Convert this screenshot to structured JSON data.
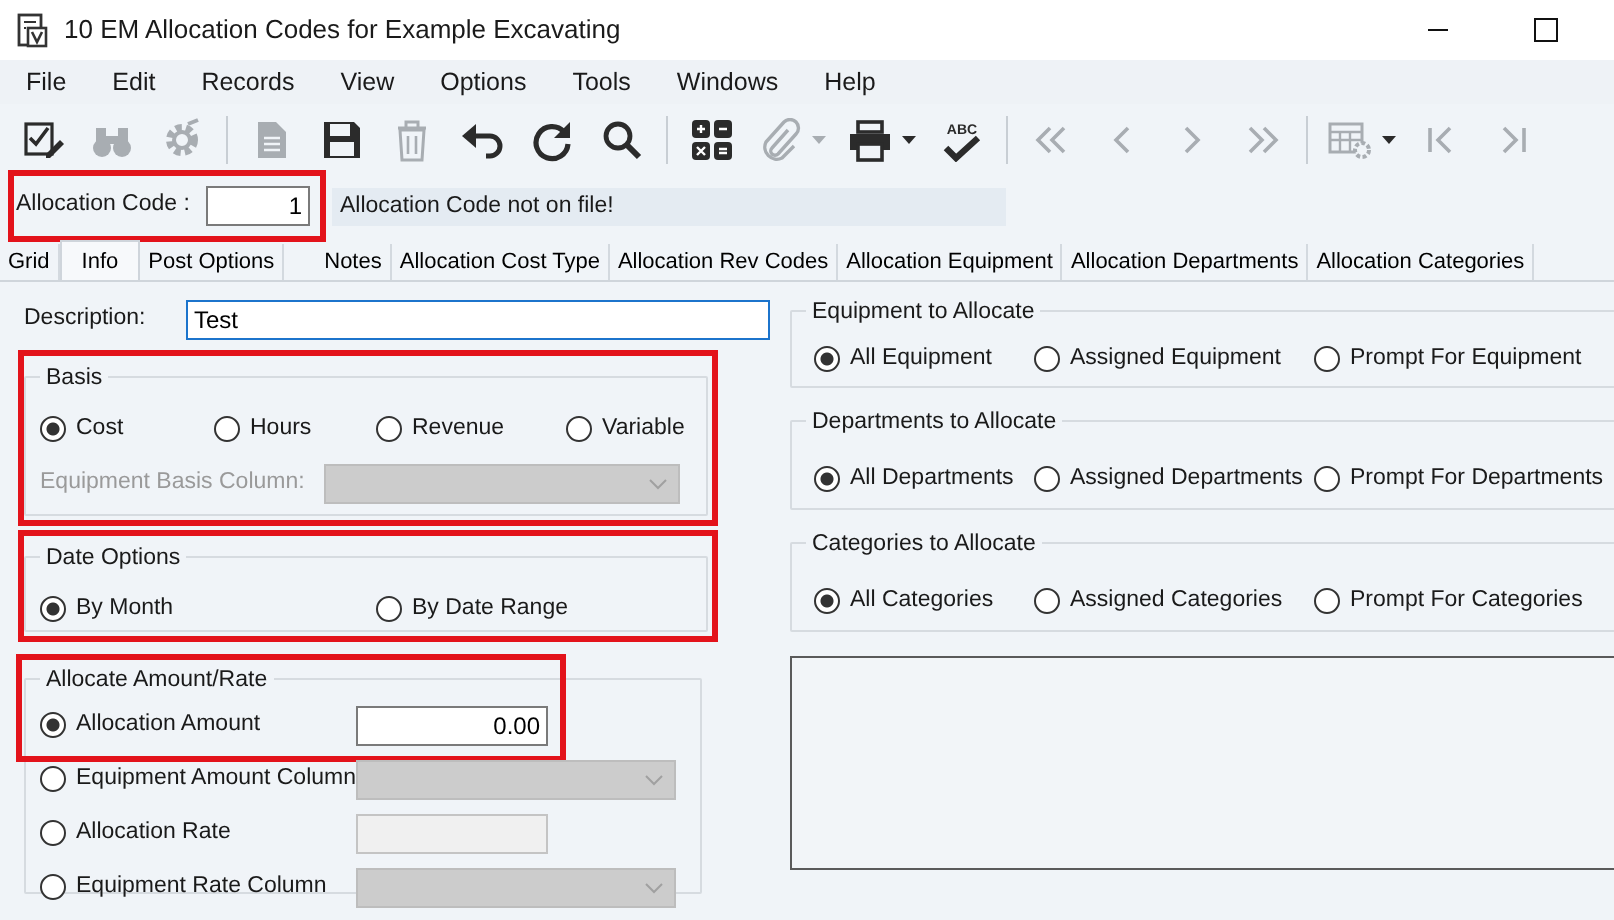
{
  "window": {
    "title": "10 EM Allocation Codes for Example Excavating"
  },
  "menu": [
    "File",
    "Edit",
    "Records",
    "View",
    "Options",
    "Tools",
    "Windows",
    "Help"
  ],
  "toolbar": [
    {
      "kind": "checklist",
      "disabled": false
    },
    {
      "kind": "binoculars",
      "disabled": true
    },
    {
      "kind": "gear",
      "disabled": true
    },
    {
      "kind": "separator"
    },
    {
      "kind": "document",
      "disabled": true
    },
    {
      "kind": "save",
      "disabled": false
    },
    {
      "kind": "trash",
      "disabled": true
    },
    {
      "kind": "undo",
      "disabled": false
    },
    {
      "kind": "redo",
      "disabled": false
    },
    {
      "kind": "search",
      "disabled": false
    },
    {
      "kind": "separator"
    },
    {
      "kind": "calculator",
      "disabled": false
    },
    {
      "kind": "paperclip",
      "disabled": true,
      "dropdown": true
    },
    {
      "kind": "printer",
      "disabled": false,
      "dropdown": true
    },
    {
      "kind": "spellcheck",
      "disabled": false,
      "label": "ABC"
    },
    {
      "kind": "separator"
    },
    {
      "kind": "first",
      "disabled": true
    },
    {
      "kind": "previous",
      "disabled": true
    },
    {
      "kind": "next",
      "disabled": true
    },
    {
      "kind": "last",
      "disabled": true
    },
    {
      "kind": "separator"
    },
    {
      "kind": "grid",
      "disabled": true,
      "dropdown": true
    },
    {
      "kind": "to-start",
      "disabled": true
    },
    {
      "kind": "to-end",
      "disabled": true
    }
  ],
  "code": {
    "label": "Allocation Code :",
    "value": "1",
    "highlighted": true,
    "message": "Allocation Code not on file!"
  },
  "tabs": [
    {
      "label": "Grid",
      "selected": false
    },
    {
      "label": "Info",
      "selected": true
    },
    {
      "label": "Post Options",
      "selected": false
    },
    {
      "label": "Notes",
      "selected": false
    },
    {
      "label": "Allocation Cost Type",
      "selected": false
    },
    {
      "label": "Allocation Rev Codes",
      "selected": false
    },
    {
      "label": "Allocation Equipment",
      "selected": false
    },
    {
      "label": "Allocation Departments",
      "selected": false
    },
    {
      "label": "Allocation Categories",
      "selected": false
    }
  ],
  "description": {
    "label": "Description:",
    "value": "Test"
  },
  "basis": {
    "title": "Basis",
    "highlighted": true,
    "options": [
      {
        "label": "Cost",
        "selected": true
      },
      {
        "label": "Hours",
        "selected": false
      },
      {
        "label": "Revenue",
        "selected": false
      },
      {
        "label": "Variable",
        "selected": false
      }
    ],
    "column": {
      "label": "Equipment Basis Column:",
      "disabled": true
    }
  },
  "date_options": {
    "title": "Date Options",
    "highlighted": true,
    "options": [
      {
        "label": "By Month",
        "selected": true
      },
      {
        "label": "By Date Range",
        "selected": false
      }
    ]
  },
  "amount_rate": {
    "title": "Allocate Amount/Rate",
    "highlighted": true,
    "options": [
      {
        "label": "Allocation Amount",
        "selected": true,
        "field": {
          "kind": "input",
          "value": "0.00",
          "disabled": false
        }
      },
      {
        "label": "Equipment Amount Column",
        "selected": false,
        "field": {
          "kind": "combo",
          "disabled": true
        }
      },
      {
        "label": "Allocation Rate",
        "selected": false,
        "field": {
          "kind": "input",
          "disabled": true
        }
      },
      {
        "label": "Equipment Rate Column",
        "selected": false,
        "field": {
          "kind": "combo",
          "disabled": true
        }
      }
    ]
  },
  "allocate_groups": [
    {
      "title": "Equipment to Allocate",
      "options": [
        {
          "label": "All Equipment",
          "selected": true
        },
        {
          "label": "Assigned Equipment",
          "selected": false
        },
        {
          "label": "Prompt For Equipment",
          "selected": false
        }
      ]
    },
    {
      "title": "Departments to Allocate",
      "options": [
        {
          "label": "All Departments",
          "selected": true
        },
        {
          "label": "Assigned Departments",
          "selected": false
        },
        {
          "label": "Prompt For Departments",
          "selected": false
        }
      ]
    },
    {
      "title": "Categories to Allocate",
      "options": [
        {
          "label": "All Categories",
          "selected": true
        },
        {
          "label": "Assigned Categories",
          "selected": false
        },
        {
          "label": "Prompt For Categories",
          "selected": false
        }
      ]
    }
  ]
}
